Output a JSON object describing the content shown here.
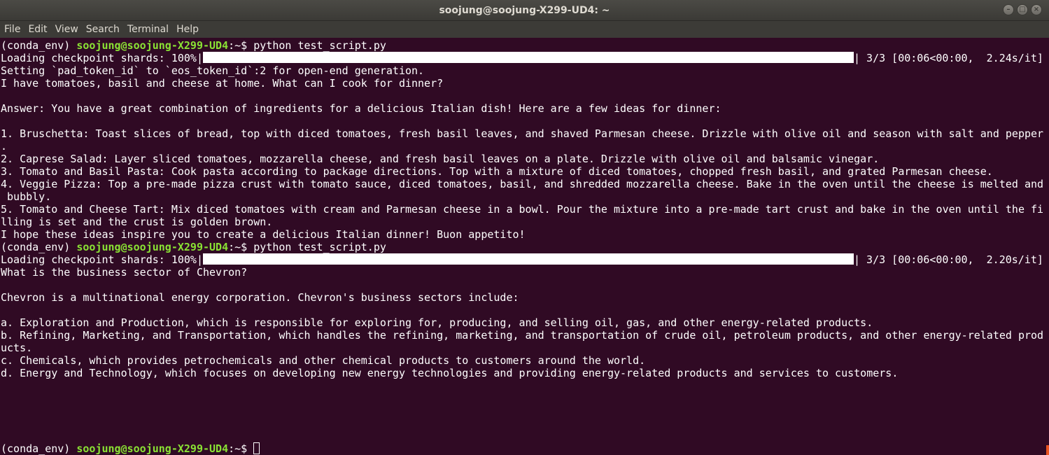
{
  "window": {
    "title": "soojung@soojung-X299-UD4: ~",
    "controls": [
      "minimize-icon",
      "maximize-icon",
      "close-icon"
    ]
  },
  "menu": [
    "File",
    "Edit",
    "View",
    "Search",
    "Terminal",
    "Help"
  ],
  "colors": {
    "background": "#300a24",
    "prompt_user": "#8ae234",
    "text": "#ffffff"
  },
  "terminal": {
    "env": "(conda_env) ",
    "user_host": "soojung@soojung-X299-UD4",
    "path_symbol": ":~$ ",
    "command": "python test_script.py",
    "run1": {
      "progress_prefix": "Loading checkpoint shards: 100%|",
      "progress_suffix": "| 3/3 [00:06<00:00,  2.24s/it]",
      "lines": [
        "Setting `pad_token_id` to `eos_token_id`:2 for open-end generation.",
        "I have tomatoes, basil and cheese at home. What can I cook for dinner?",
        "",
        "Answer: You have a great combination of ingredients for a delicious Italian dish! Here are a few ideas for dinner:",
        "",
        "1. Bruschetta: Toast slices of bread, top with diced tomatoes, fresh basil leaves, and shaved Parmesan cheese. Drizzle with olive oil and season with salt and pepper",
        ".",
        "2. Caprese Salad: Layer sliced tomatoes, mozzarella cheese, and fresh basil leaves on a plate. Drizzle with olive oil and balsamic vinegar.",
        "3. Tomato and Basil Pasta: Cook pasta according to package directions. Top with a mixture of diced tomatoes, chopped fresh basil, and grated Parmesan cheese.",
        "4. Veggie Pizza: Top a pre-made pizza crust with tomato sauce, diced tomatoes, basil, and shredded mozzarella cheese. Bake in the oven until the cheese is melted and",
        " bubbly.",
        "5. Tomato and Cheese Tart: Mix diced tomatoes with cream and Parmesan cheese in a bowl. Pour the mixture into a pre-made tart crust and bake in the oven until the fi",
        "lling is set and the crust is golden brown.",
        "I hope these ideas inspire you to create a delicious Italian dinner! Buon appetito!"
      ]
    },
    "run2": {
      "progress_prefix": "Loading checkpoint shards: 100%|",
      "progress_suffix": "| 3/3 [00:06<00:00,  2.20s/it]",
      "lines": [
        "What is the business sector of Chevron?",
        "",
        "Chevron is a multinational energy corporation. Chevron's business sectors include:",
        "",
        "a. Exploration and Production, which is responsible for exploring for, producing, and selling oil, gas, and other energy-related products.",
        "b. Refining, Marketing, and Transportation, which handles the refining, marketing, and transportation of crude oil, petroleum products, and other energy-related prod",
        "ucts.",
        "c. Chemicals, which provides petrochemicals and other chemical products to customers around the world.",
        "d. Energy and Technology, which focuses on developing new energy technologies and providing energy-related products and services to customers."
      ]
    }
  }
}
